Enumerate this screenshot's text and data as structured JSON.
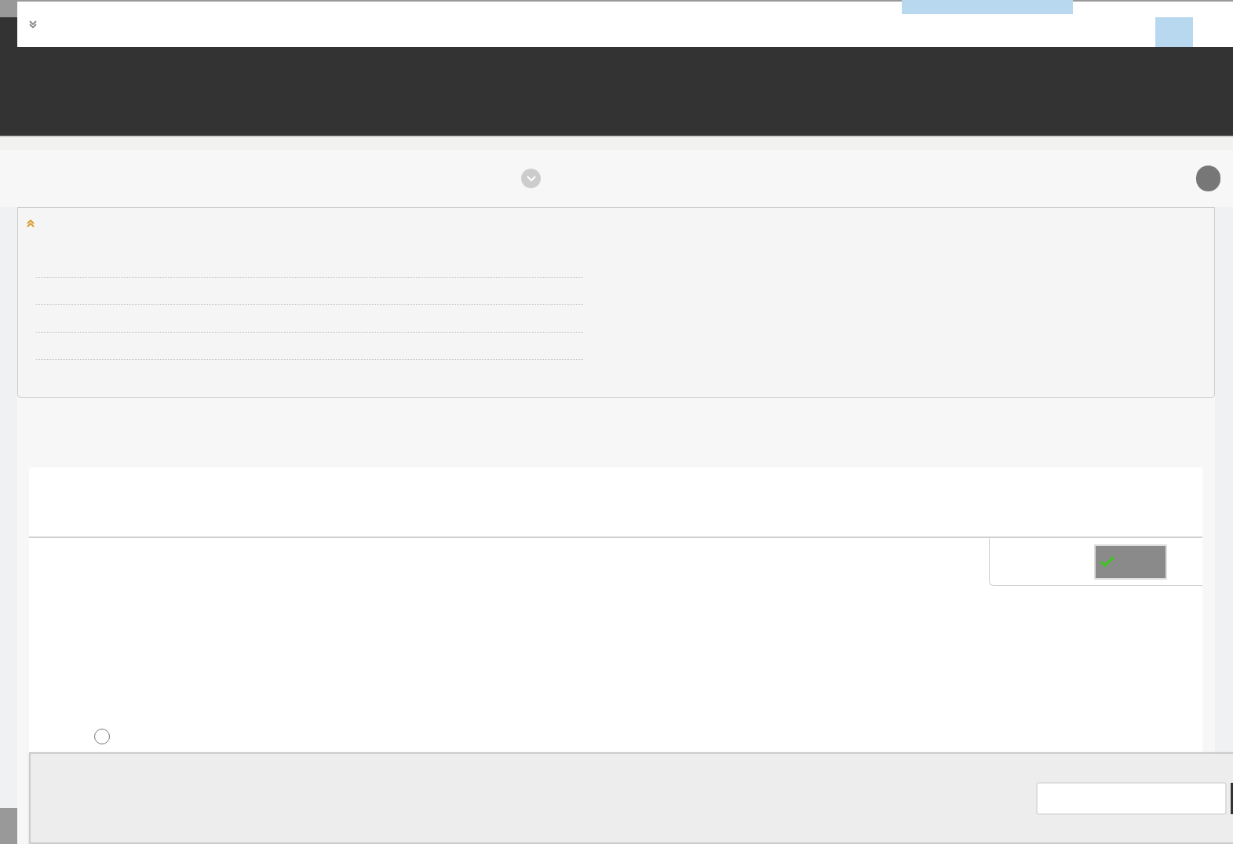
{
  "filter_panel": {
    "expanded": true
  },
  "option_radio": {
    "checked": false
  }
}
